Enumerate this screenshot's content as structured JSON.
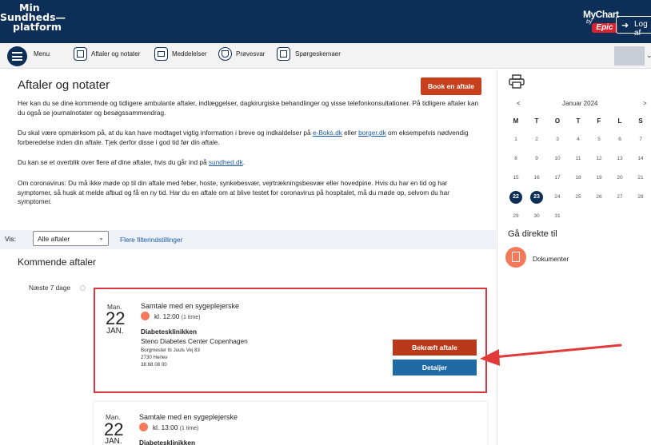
{
  "header": {
    "logo_line1": "Min",
    "logo_line2": "Sundheds—",
    "logo_line3": "platform",
    "mychart": "MyChart",
    "mychart_by": "by",
    "epic": "Epic",
    "logout": "Log af"
  },
  "nav": {
    "menu": "Menu",
    "items": [
      {
        "label": "Aftaler og notater"
      },
      {
        "label": "Meddelelser"
      },
      {
        "label": "Prøvesvar"
      },
      {
        "label": "Spørgeskemaer"
      }
    ]
  },
  "main": {
    "title": "Aftaler og notater",
    "book_button": "Book en aftale",
    "para1": "Her kan du se dine kommende og tidligere ambulante aftaler, indlæggelser, dagkirurgiske behandlinger og visse telefonkonsultationer. På tidligere aftaler kan du også se journalnotater og besøgssammendrag.",
    "para2_a": "Du skal være opmærksom på, at du kan have modtaget vigtig information i breve og indkaldelser på ",
    "para2_link1": "e-Boks.dk",
    "para2_b": " eller ",
    "para2_link2": "borger.dk",
    "para2_c": " om eksempelvis nødvendig forberedelse inden din aftale. Tjek derfor disse i god tid før din aftale.",
    "para3_a": "Du kan se et overblik over flere af dine aftaler, hvis du går ind på ",
    "para3_link": "sundhed.dk",
    "para3_b": ".",
    "para4": "Om coronavirus: Du må ikke møde op til din aftale med feber, hoste, synkebesvær, vejrtrækningsbesvær eller hovedpine. Hvis du har en tid og har symptomer, så husk at melde afbud og få en ny tid. Har du en aftale om at blive testet for coronavirus på hospitalet, må du møde op, selvom du har symptomer.",
    "filter_label": "Vis:",
    "filter_value": "Alle aftaler",
    "more_filters": "Flere filterindstillinger",
    "section_title": "Kommende aftaler",
    "timeline_label": "Næste 7 dage"
  },
  "appointments": [
    {
      "day_abbr": "Man.",
      "day_num": "22",
      "month": "JAN.",
      "title": "Samtale med en sygeplejerske",
      "time": "kl. 12:00",
      "duration": "(1 time)",
      "clinic": "Diabetesklinikken",
      "center": "Steno Diabetes Center Copenhagen",
      "address1": "Borgmester Ib Juuls Vej 83",
      "address2": "2730 Herlev",
      "phone": "38 68 08 00",
      "confirm": "Bekræft aftale",
      "details": "Detaljer"
    },
    {
      "day_abbr": "Man.",
      "day_num": "22",
      "month": "JAN.",
      "title": "Samtale med en sygeplejerske",
      "time": "kl. 13:00",
      "duration": "(1 time)",
      "clinic": "Diabetesklinikken"
    }
  ],
  "calendar": {
    "prev": "<",
    "next": ">",
    "month": "Januar 2024",
    "weekdays": [
      "M",
      "T",
      "O",
      "T",
      "F",
      "L",
      "S"
    ],
    "weeks": [
      [
        "1",
        "2",
        "3",
        "4",
        "5",
        "6",
        "7"
      ],
      [
        "8",
        "9",
        "10",
        "11",
        "12",
        "13",
        "14"
      ],
      [
        "15",
        "16",
        "17",
        "18",
        "19",
        "20",
        "21"
      ],
      [
        "22",
        "23",
        "24",
        "25",
        "26",
        "27",
        "28"
      ],
      [
        "29",
        "30",
        "31",
        "",
        "",
        "",
        ""
      ]
    ],
    "selected": [
      "22",
      "23"
    ]
  },
  "sidebar": {
    "goto_title": "Gå direkte til",
    "documents": "Dokumenter"
  },
  "colors": {
    "header_bg": "#0d2e57",
    "book_button": "#c8411e",
    "confirm_button": "#b83a1a",
    "details_button": "#1f6aa5",
    "highlight_red": "#d9363e",
    "accent_orange": "#f4795b"
  }
}
